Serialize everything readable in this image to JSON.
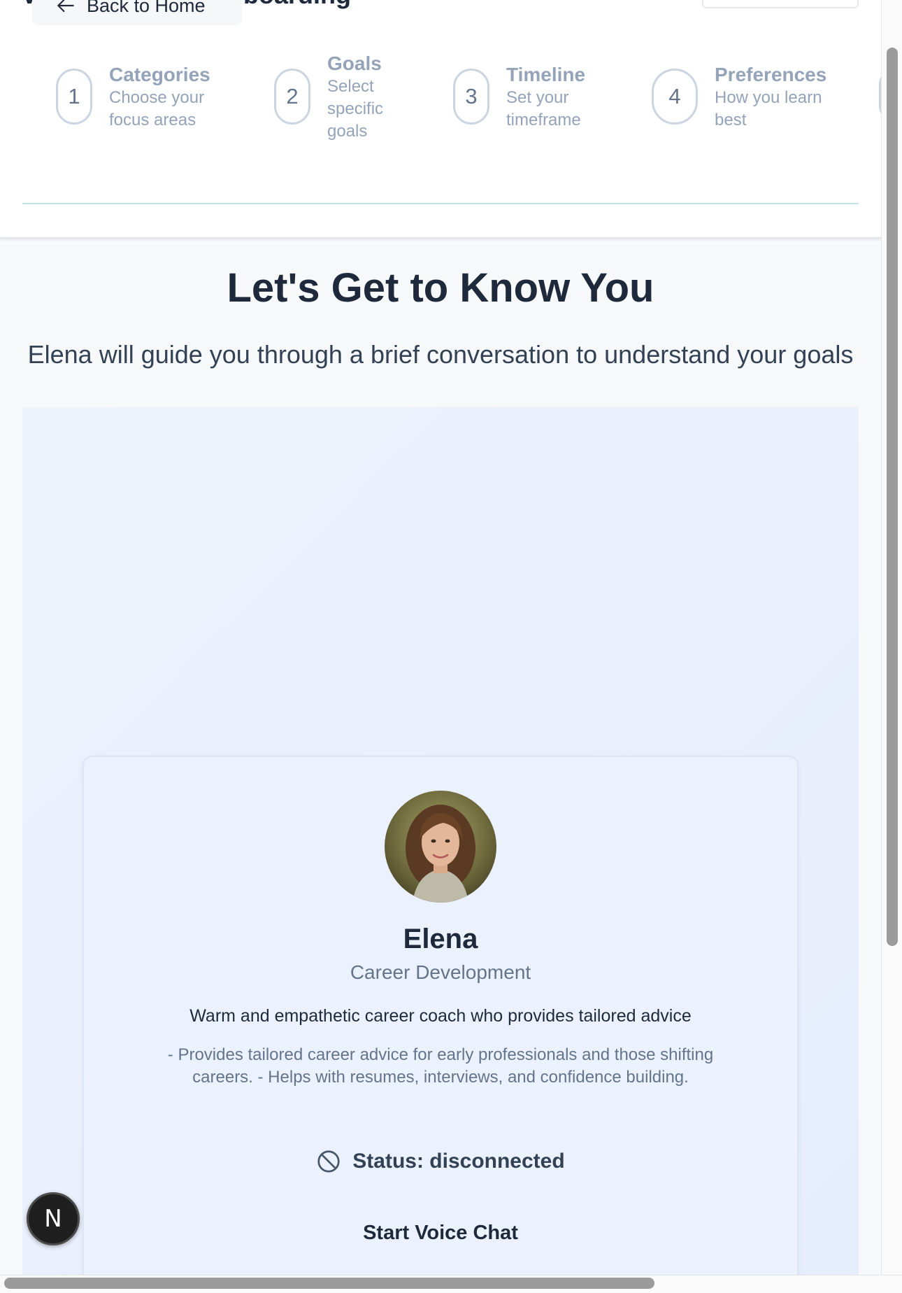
{
  "header": {
    "page_heading_left": "V",
    "page_heading_right": "boarding",
    "back_button_label": "Back to Home",
    "steps": [
      {
        "number": "1",
        "title": "Categories",
        "description": "Choose your focus areas"
      },
      {
        "number": "2",
        "title": "Goals",
        "description": "Select specific goals"
      },
      {
        "number": "3",
        "title": "Timeline",
        "description": "Set your timeframe"
      },
      {
        "number": "4",
        "title": "Preferences",
        "description": "How you learn best"
      }
    ]
  },
  "main": {
    "title": "Let's Get to Know You",
    "subtitle": "Elena will guide you through a brief conversation to understand your goals"
  },
  "agent": {
    "name": "Elena",
    "role": "Career Development",
    "tagline": "Warm and empathetic career coach who provides tailored advice",
    "bio": "- Provides tailored career advice for early professionals and those shifting careers. - Helps with resumes, interviews, and confidence building.",
    "status_text": "Status: disconnected",
    "start_button_label": "Start Voice Chat"
  },
  "fab": {
    "label": "N"
  },
  "colors": {
    "accent_line": "#bfe3ee",
    "panel_bg": "#e6edfd",
    "muted_text": "#94a3b8",
    "heading_text": "#1e293b"
  },
  "icons": {
    "back": "arrow-left-icon",
    "status": "ban-icon"
  }
}
